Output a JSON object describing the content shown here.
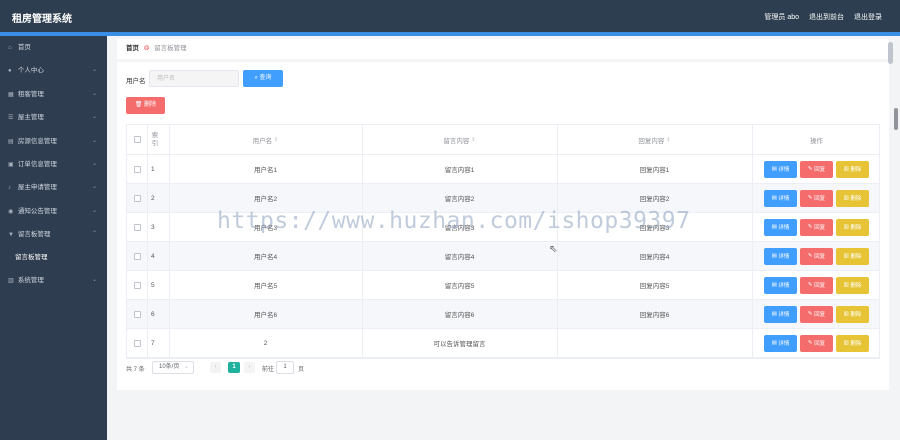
{
  "app": {
    "title": "租房管理系统",
    "admin_label": "管理员 abo",
    "back_label": "退出到前台",
    "logout_label": "退出登录"
  },
  "sidebar": {
    "items": [
      {
        "label": "首页",
        "icon": "home-icon",
        "has_children": false
      },
      {
        "label": "个人中心",
        "icon": "user-icon",
        "has_children": true
      },
      {
        "label": "租客管理",
        "icon": "grid-icon",
        "has_children": true
      },
      {
        "label": "屋主管理",
        "icon": "list-icon",
        "has_children": true
      },
      {
        "label": "房源信息管理",
        "icon": "house-icon",
        "has_children": true
      },
      {
        "label": "订单信息管理",
        "icon": "order-icon",
        "has_children": true
      },
      {
        "label": "屋主申请管理",
        "icon": "bell-icon",
        "has_children": true
      },
      {
        "label": "通知公告管理",
        "icon": "notice-icon",
        "has_children": true
      },
      {
        "label": "留言板管理",
        "icon": "filter-icon",
        "has_children": true,
        "expanded": true
      },
      {
        "label": "系统管理",
        "icon": "settings-icon",
        "has_children": true
      }
    ],
    "sub_item": "留言板管理"
  },
  "breadcrumb": {
    "home": "首页",
    "current": "留言板管理"
  },
  "search": {
    "label": "用户名",
    "placeholder": "用户名",
    "button": "查询"
  },
  "toolbar": {
    "delete_label": "删除"
  },
  "table": {
    "headers": {
      "index": "索引",
      "username": "用户名",
      "message": "留言内容",
      "reply": "回复内容",
      "actions": "操作"
    },
    "rows": [
      {
        "index": "1",
        "username": "用户名1",
        "message": "留言内容1",
        "reply": "回复内容1"
      },
      {
        "index": "2",
        "username": "用户名2",
        "message": "留言内容2",
        "reply": "回复内容2"
      },
      {
        "index": "3",
        "username": "用户名3",
        "message": "留言内容3",
        "reply": "回复内容3"
      },
      {
        "index": "4",
        "username": "用户名4",
        "message": "留言内容4",
        "reply": "回复内容4"
      },
      {
        "index": "5",
        "username": "用户名5",
        "message": "留言内容5",
        "reply": "回复内容5"
      },
      {
        "index": "6",
        "username": "用户名6",
        "message": "留言内容6",
        "reply": "回复内容6"
      },
      {
        "index": "7",
        "username": "2",
        "message": "可以告诉管理留言",
        "reply": ""
      }
    ],
    "actions": {
      "detail": "详情",
      "reply": "回复",
      "delete": "删除"
    }
  },
  "pagination": {
    "total": "共 7 条",
    "page_size": "10条/页",
    "current_page": "1",
    "goto_label": "前往",
    "goto_value": "1",
    "goto_unit": "页"
  },
  "watermark": "https://www.huzhan.com/ishop39397",
  "colors": {
    "topbar": "#2c3e50",
    "accent": "#3a8ee6",
    "sidebar": "#2f3d50",
    "primary": "#409eff",
    "danger": "#f56c6c",
    "warning": "#e6c436",
    "pager_active": "#1fb19e"
  }
}
